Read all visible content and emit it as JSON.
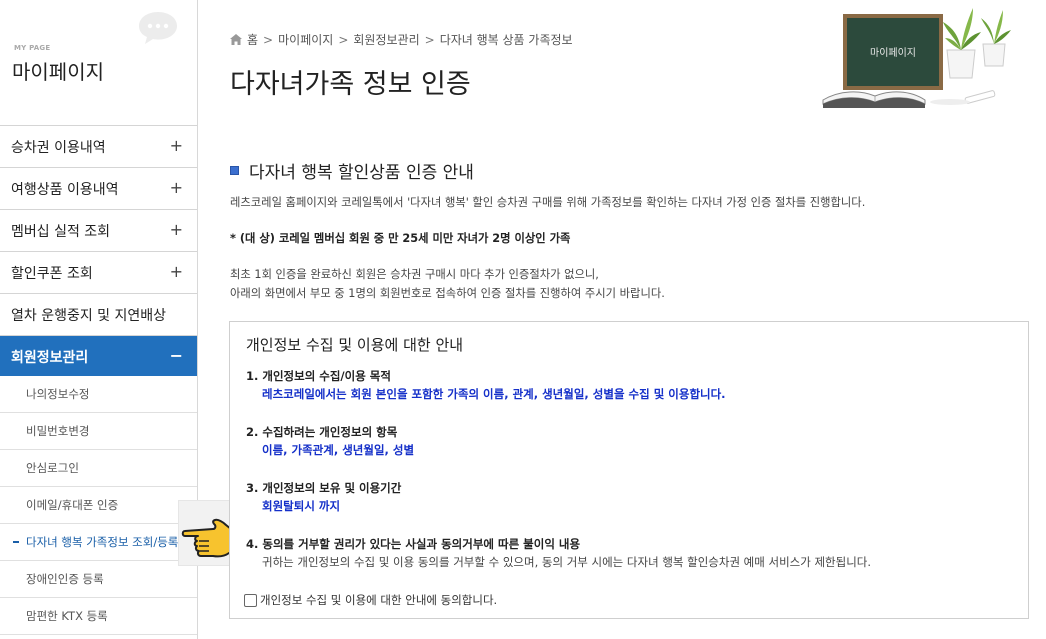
{
  "sidebar": {
    "en_title": "MY PAGE",
    "title": "마이페이지",
    "menu": [
      {
        "label": "승차권 이용내역",
        "sign": "+"
      },
      {
        "label": "여행상품 이용내역",
        "sign": "+"
      },
      {
        "label": "멤버십 실적 조회",
        "sign": "+"
      },
      {
        "label": "할인쿠폰 조회",
        "sign": "+"
      },
      {
        "label": "열차 운행중지 및 지연배상",
        "sign": ""
      },
      {
        "label": "회원정보관리",
        "sign": "−"
      }
    ],
    "sub": [
      {
        "label": "나의정보수정"
      },
      {
        "label": "비밀번호변경"
      },
      {
        "label": "안심로그인"
      },
      {
        "label": "이메일/휴대폰 인증"
      },
      {
        "label": "다자녀 행복 가족정보 조회/등록"
      },
      {
        "label": "장애인인증 등록"
      },
      {
        "label": "맘편한 KTX 등록"
      }
    ]
  },
  "breadcrumb": [
    "홈",
    "마이페이지",
    "회원정보관리",
    "다자녀 행복 상품 가족정보"
  ],
  "page_title": "다자녀가족 정보 인증",
  "illustration": {
    "board_text": "마이페이지"
  },
  "section": {
    "title": "다자녀 행복 할인상품 인증 안내",
    "intro": "레츠코레일 홈페이지와 코레일톡에서 '다자녀 행복' 할인 승차권 구매를 위해 가족정보를 확인하는 다자녀 가정 인증 절차를 진행합니다.",
    "target": "* (대 상) 코레일 멤버십 회원 중 만 25세 미만 자녀가 2명 이상인 가족",
    "note1": "최초 1회 인증을 완료하신 회원은 승차권 구매시 마다 추가 인증절차가 없으니,",
    "note2": "아래의 화면에서 부모 중 1명의 회원번호로 접속하여 인증 절차를 진행하여 주시기 바랍니다."
  },
  "privacy": {
    "title": "개인정보 수집 및 이용에 대한 안내",
    "items": [
      {
        "title": "1.  개인정보의 수집/이용 목적",
        "body": "레츠코레일에서는 회원 본인을 포함한 가족의 이름, 관계, 생년월일, 성별을 수집 및 이용합니다."
      },
      {
        "title": "2.  수집하려는 개인정보의 항목",
        "body": "이름, 가족관계, 생년월일, 성별"
      },
      {
        "title": "3.  개인정보의 보유 및 이용기간",
        "body": "회원탈퇴시 까지"
      },
      {
        "title": "4.  동의를 거부할 권리가 있다는 사실과 동의거부에 따른 불이익 내용",
        "body": "귀하는 개인정보의 수집 및 이용 동의를 거부할 수 있으며, 동의 거부 시에는 다자녀 행복 할인승차권 예매 서비스가 제한됩니다."
      }
    ],
    "agree_label": "개인정보 수집 및 이용에 대한 안내에 동의합니다."
  },
  "colors": {
    "accent": "#2170bd",
    "highlight_text": "#1530c9",
    "bullet": "#3b6fcf"
  }
}
